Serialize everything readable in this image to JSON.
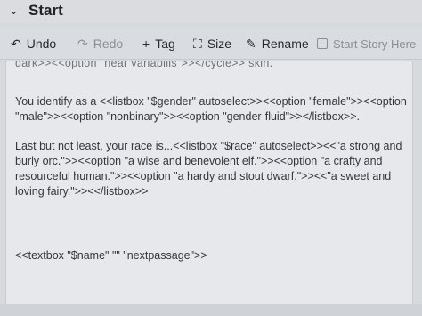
{
  "window": {
    "title": "Start",
    "chevron": "⌄"
  },
  "toolbar": {
    "undo_label": "Undo",
    "redo_label": "Redo",
    "tag_label": "Tag",
    "size_label": "Size",
    "rename_label": "Rename",
    "start_story_label": "Start Story Here"
  },
  "passage": {
    "partial_line": "dark>><<option \"hear variabilis\">></cycle>> skin.",
    "lines": [
      "You identify as a <<listbox \"$gender\" autoselect>><<option \"female\">><<option",
      "\"male\">><<option \"nonbinary\">><<option \"gender-fluid\">></listbox>>.",
      "Last but not least, your race is...<<listbox \"$race\" autoselect>><<\"a strong and",
      "burly orc.\">><<option \"a wise and benevolent elf.\">><<option \"a crafty and",
      "resourceful human.\">><<option \"a hardy and stout dwarf.\">><<\"a sweet and",
      "loving fairy.\">><</listbox>>",
      "<<textbox \"$name\" \"\" \"nextpassage\">>"
    ]
  }
}
